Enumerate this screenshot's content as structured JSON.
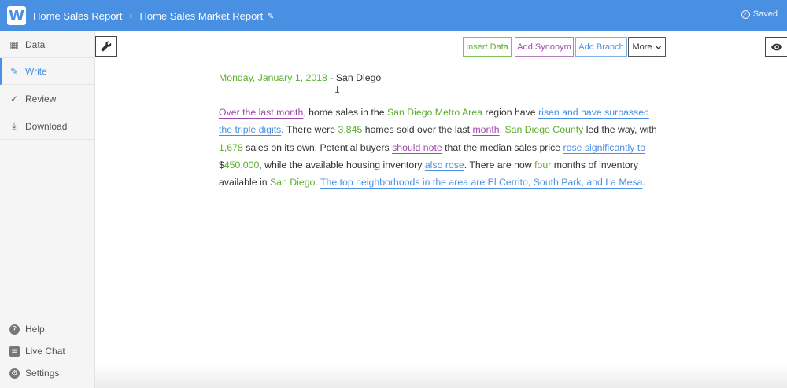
{
  "app": {
    "logo_letter": "W",
    "breadcrumb_parent": "Home Sales Report",
    "breadcrumb_separator": "›",
    "breadcrumb_current": "Home Sales Market Report",
    "saved_label": "Saved",
    "accent_color": "#4a90e2"
  },
  "sidebar": {
    "items": [
      {
        "label": "Data",
        "icon": "grid-icon"
      },
      {
        "label": "Write",
        "icon": "pencil-icon",
        "active": true
      },
      {
        "label": "Review",
        "icon": "check-icon"
      },
      {
        "label": "Download",
        "icon": "download-icon"
      }
    ],
    "bottom": [
      {
        "label": "Help",
        "icon": "question-icon"
      },
      {
        "label": "Live Chat",
        "icon": "chat-icon"
      },
      {
        "label": "Settings",
        "icon": "gear-icon"
      }
    ]
  },
  "toolbar": {
    "insert_data": "Insert Data",
    "add_synonym": "Add Synonym",
    "add_branch": "Add Branch",
    "more": "More"
  },
  "document": {
    "headline": {
      "date": "Monday, January 1, 2018",
      "separator": "-",
      "city": "San Diego"
    },
    "paragraph": [
      {
        "t": "Over the last month",
        "k": "p"
      },
      {
        "t": ", home sales in the ",
        "k": ""
      },
      {
        "t": "San Diego Metro Area",
        "k": "g"
      },
      {
        "t": " region have ",
        "k": ""
      },
      {
        "t": "risen and have surpassed the triple digits",
        "k": "b"
      },
      {
        "t": ". There were ",
        "k": ""
      },
      {
        "t": "3,845",
        "k": "g"
      },
      {
        "t": " homes sold over the last ",
        "k": ""
      },
      {
        "t": "month",
        "k": "p"
      },
      {
        "t": ". ",
        "k": ""
      },
      {
        "t": "San Diego County",
        "k": "g"
      },
      {
        "t": " led the way, with ",
        "k": ""
      },
      {
        "t": "1,678",
        "k": "g"
      },
      {
        "t": " sales on its own. Potential buyers ",
        "k": ""
      },
      {
        "t": "should note",
        "k": "p"
      },
      {
        "t": " that the median sales price ",
        "k": ""
      },
      {
        "t": "rose significantly to",
        "k": "b"
      },
      {
        "t": " $",
        "k": ""
      },
      {
        "t": "450,000",
        "k": "g"
      },
      {
        "t": ", while the available housing inventory ",
        "k": ""
      },
      {
        "t": "also rose",
        "k": "b"
      },
      {
        "t": ". There are now ",
        "k": ""
      },
      {
        "t": "four",
        "k": "g"
      },
      {
        "t": " months of inventory available in ",
        "k": ""
      },
      {
        "t": "San Diego",
        "k": "g"
      },
      {
        "t": ". ",
        "k": ""
      },
      {
        "t": "The top neighborhoods in the area are El Cerrito, South Park, and La Mesa",
        "k": "b"
      },
      {
        "t": ".",
        "k": ""
      }
    ]
  },
  "colors": {
    "data_green": "#5cae2c",
    "synonym_purple": "#9c4aa8",
    "branch_blue": "#4a90e2"
  }
}
